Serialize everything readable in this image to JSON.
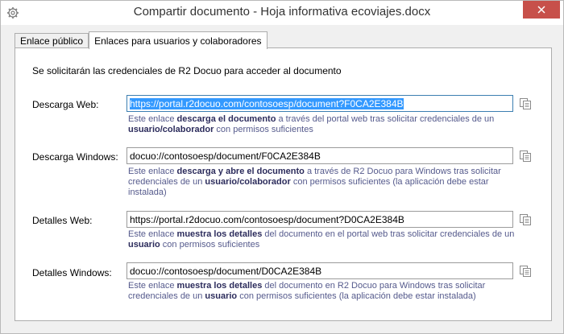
{
  "window": {
    "title": "Compartir documento - Hoja informativa ecoviajes.docx"
  },
  "tabs": [
    {
      "label": "Enlace público",
      "active": false
    },
    {
      "label": "Enlaces para usuarios y colaboradores",
      "active": true
    }
  ],
  "notice": "Se solicitarán las credenciales de R2 Docuo para acceder al documento",
  "rows": [
    {
      "label": "Descarga Web:",
      "value": "https://portal.r2docuo.com/contosoesp/document?F0CA2E384B",
      "desc": {
        "p1": "Este enlace ",
        "b1": "descarga el documento",
        "p2": " a través del portal web tras solicitar credenciales de un ",
        "b2": "usuario/colaborador",
        "p3": " con permisos suficientes"
      }
    },
    {
      "label": "Descarga Windows:",
      "value": "docuo://contosoesp/document/F0CA2E384B",
      "desc": {
        "p1": "Este enlace ",
        "b1": "descarga y abre el documento",
        "p2": " a través de R2 Docuo para Windows tras solicitar credenciales de un ",
        "b2": "usuario/colaborador",
        "p3": " con permisos suficientes (la aplicación debe estar instalada)"
      }
    },
    {
      "label": "Detalles Web:",
      "value": "https://portal.r2docuo.com/contosoesp/document?D0CA2E384B",
      "desc": {
        "p1": "Este enlace ",
        "b1": "muestra los detalles",
        "p2": " del documento en el portal web tras solicitar credenciales de un ",
        "b2": "usuario",
        "p3": " con permisos suficientes"
      }
    },
    {
      "label": "Detalles Windows:",
      "value": "docuo://contosoesp/document/D0CA2E384B",
      "desc": {
        "p1": "Este enlace ",
        "b1": "muestra los detalles",
        "p2": " del documento en R2 Docuo para Windows tras solicitar credenciales de un ",
        "b2": "usuario",
        "p3": " con permisos suficientes (la aplicación debe estar instalada)"
      }
    }
  ],
  "icons": {
    "settings": "gear-icon",
    "close": "close-icon",
    "copy": "copy-icon"
  },
  "colors": {
    "close_button": "#c7504a",
    "selection": "#3399ff",
    "description_text": "#555a8c"
  }
}
